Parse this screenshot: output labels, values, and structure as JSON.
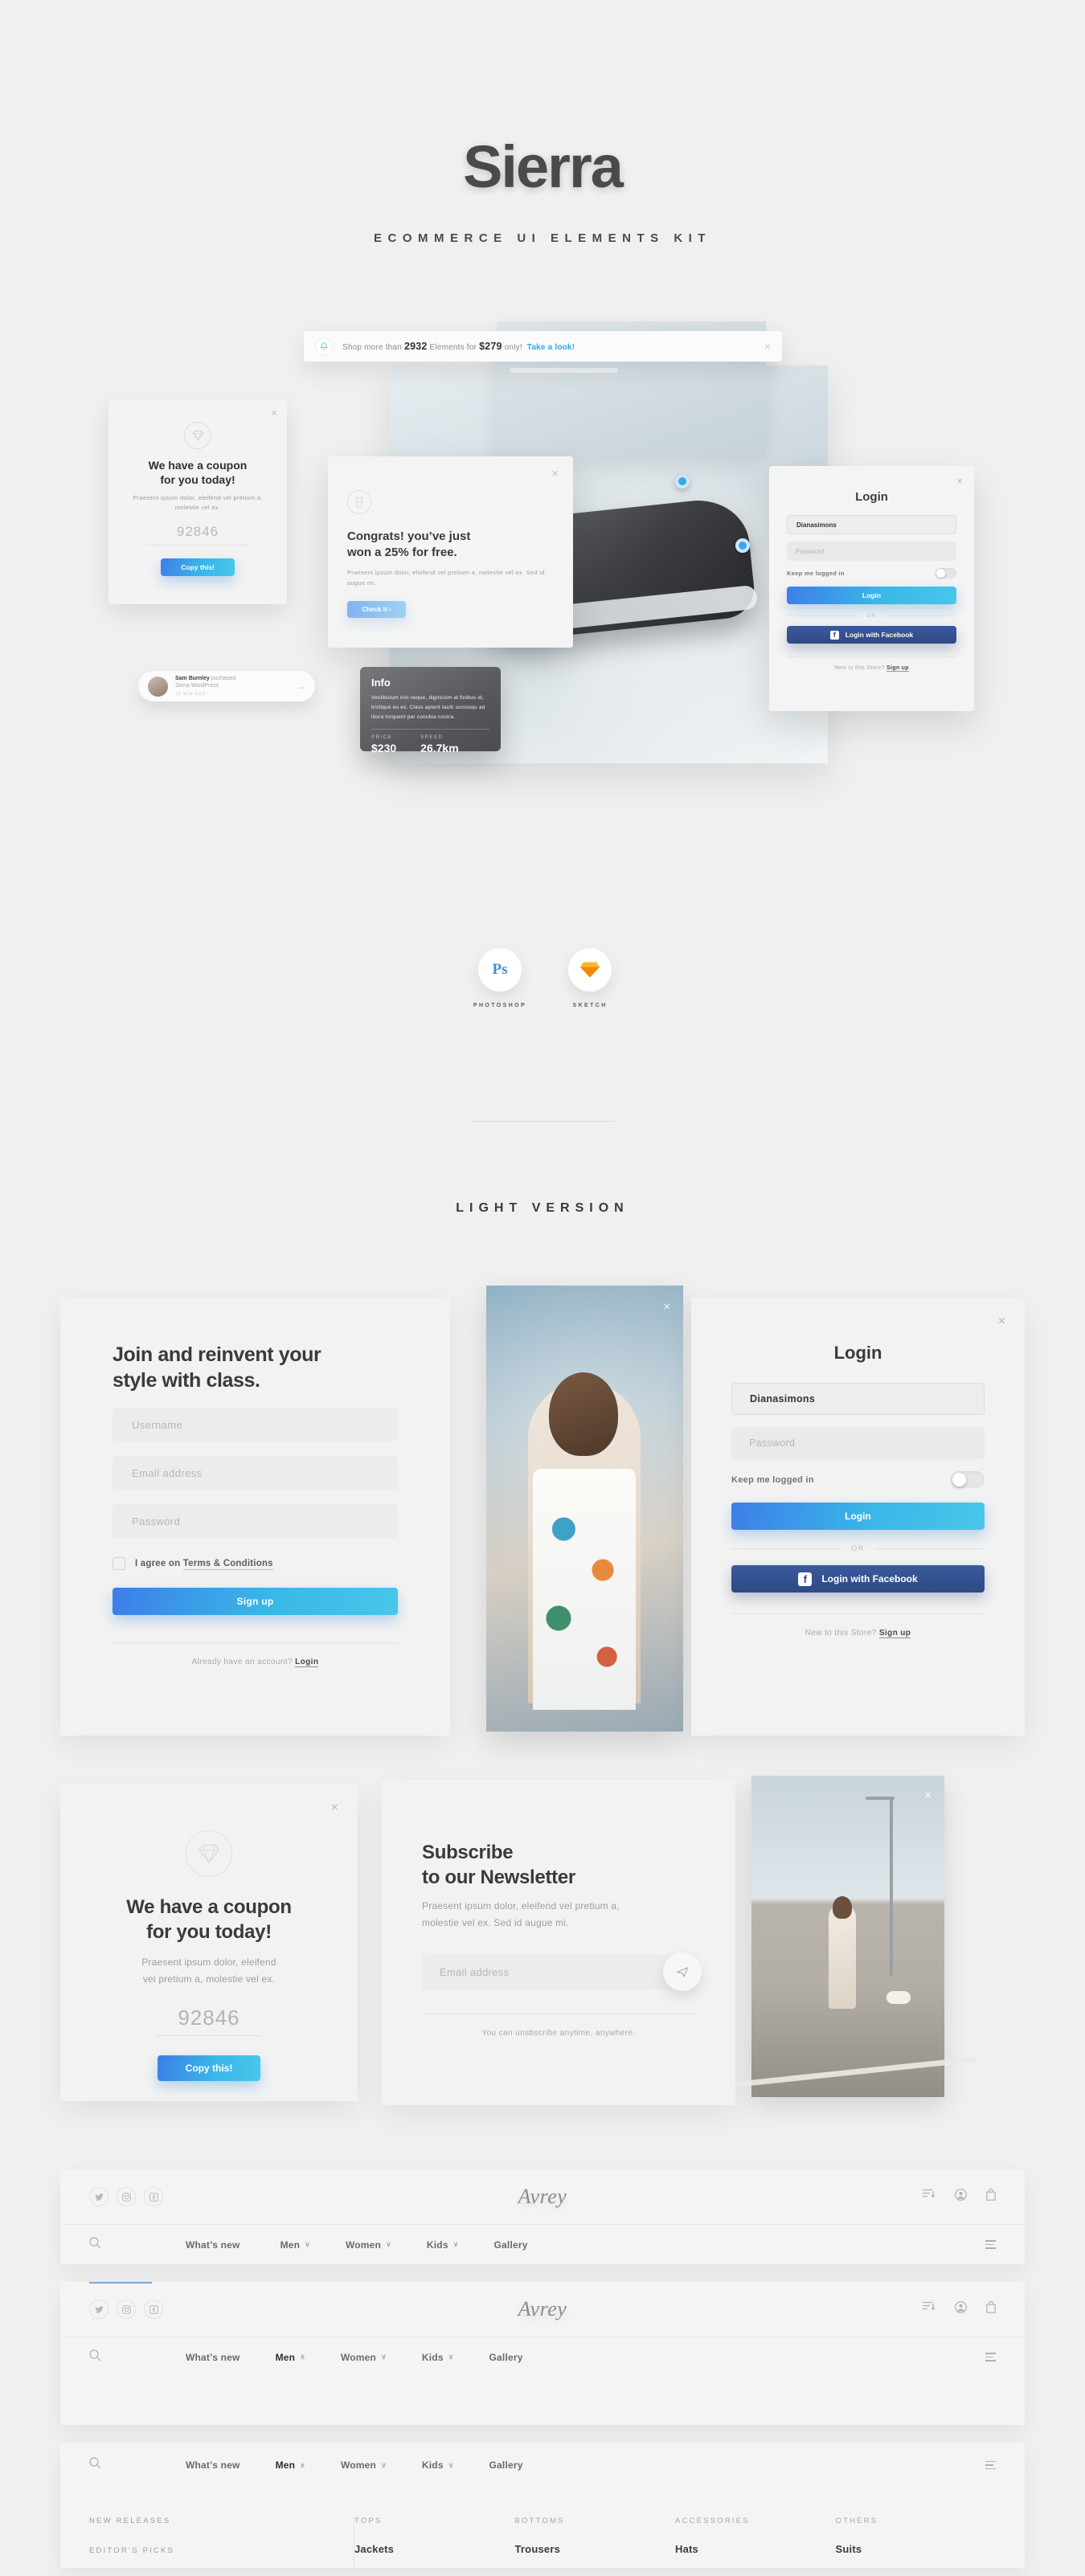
{
  "hero": {
    "title": "Sierra",
    "subtitle": "ECOMMERCE UI ELEMENTS KIT"
  },
  "banner": {
    "icon": "bell-icon",
    "text_before": "Shop more than",
    "count": "2932",
    "text_mid": "Elements for",
    "price": "$279",
    "text_after": "only!",
    "link": "Take a look!",
    "close": "×"
  },
  "coupon_mini": {
    "close": "×",
    "icon": "diamond-icon",
    "heading": "We have a coupon\nfor you today!",
    "heading_line1": "We have a coupon",
    "heading_line2": "for you today!",
    "body": "Praesent ipsum dolor, eleifend vel pretium a, molestie vel ex.",
    "code": "92846",
    "button": "Copy this!"
  },
  "congrats": {
    "close": "×",
    "icon": "medal-icon",
    "heading_line1": "Congrats! you’ve just",
    "heading_line2": "won a 25% for free.",
    "body": "Praesent ipsum dolor, eleifend vel pretium a, molestie vel ex. Sed id augue mi.",
    "button": "Check it ›"
  },
  "info_card": {
    "title": "Info",
    "body": "Vestibulum nisl neque, dignissim at finibus id, tristique eu ex. Class aptent taciti sociosqu ad litora torquent per conubia nostra.",
    "stats": [
      {
        "label": "PRICE",
        "value": "$230"
      },
      {
        "label": "SPEED",
        "value": "26.7km"
      }
    ]
  },
  "toast": {
    "name": "Sam Burnley",
    "action": "puchased",
    "product": "Siena WordPress",
    "time": "35 MIN AGO",
    "arrow": "→"
  },
  "hero_login": {
    "close": "×",
    "title": "Login",
    "username_value": "Dianasimons",
    "password_placeholder": "Password",
    "toggle_label": "Keep me logged in",
    "login_button": "Login",
    "or": "OR",
    "facebook_button": "Login with Facebook",
    "facebook_badge": "f",
    "footer_text": "New to this Store?",
    "footer_link": "Sign up"
  },
  "formats": [
    {
      "icon": "photoshop-icon",
      "glyph": "Ps",
      "label": "PHOTOSHOP"
    },
    {
      "icon": "sketch-icon",
      "glyph": "",
      "label": "SKETCH"
    }
  ],
  "section": {
    "title": "LIGHT VERSION"
  },
  "signup": {
    "heading_line1": "Join and reinvent your",
    "heading_line2": "style with class.",
    "fields": [
      {
        "name": "username-field",
        "placeholder": "Username"
      },
      {
        "name": "email-field",
        "placeholder": "Email address"
      },
      {
        "name": "password-field",
        "placeholder": "Password"
      }
    ],
    "terms_prefix": "I agree on",
    "terms_link": "Terms & Conditions",
    "button": "Sign up",
    "footer_text": "Already have an account?",
    "footer_link": "Login"
  },
  "login": {
    "close": "×",
    "title": "Login",
    "username_value": "Dianasimons",
    "password_placeholder": "Password",
    "toggle_label": "Keep me logged in",
    "login_button": "Login",
    "or": "OR",
    "facebook_button": "Login with Facebook",
    "facebook_badge": "f",
    "footer_text": "New to this Store?",
    "footer_link": "Sign up"
  },
  "coupon": {
    "close": "×",
    "icon": "diamond-icon",
    "heading_line1": "We have a coupon",
    "heading_line2": "for you today!",
    "body_line1": "Praesent ipsum dolor, eleifend",
    "body_line2": "vel pretium a, molestie vel ex.",
    "code": "92846",
    "button": "Copy this!"
  },
  "newsletter": {
    "heading_line1": "Subscribe",
    "heading_line2": "to our Newsletter",
    "body_line1": "Praesent ipsum dolor, eleifend vel pretium a,",
    "body_line2": "molestie vel ex. Sed id augue mi.",
    "placeholder": "Email address",
    "send_icon": "send-icon",
    "footer": "You can unsbscribe anytime, anywhere."
  },
  "photos": {
    "portrait_close": "×",
    "street_close": "×"
  },
  "navbar": {
    "brand": "Avrey",
    "socials": [
      {
        "name": "twitter-icon",
        "glyph": "🐦"
      },
      {
        "name": "instagram-icon",
        "glyph": "▢"
      },
      {
        "name": "facebook-icon",
        "glyph": "f"
      }
    ],
    "icons": [
      {
        "name": "filter-icon"
      },
      {
        "name": "account-icon"
      },
      {
        "name": "bag-icon"
      }
    ],
    "search_icon": "search-icon",
    "menu": [
      {
        "label": "What’s new",
        "caret": ""
      },
      {
        "label": "Men",
        "caret": "∨"
      },
      {
        "label": "Women",
        "caret": "∨"
      },
      {
        "label": "Kids",
        "caret": "∨"
      },
      {
        "label": "Gallery",
        "caret": ""
      }
    ],
    "menu_open": [
      {
        "label": "What’s new",
        "caret": ""
      },
      {
        "label": "Men",
        "caret": "∧"
      },
      {
        "label": "Women",
        "caret": "∨"
      },
      {
        "label": "Kids",
        "caret": "∨"
      },
      {
        "label": "Gallery",
        "caret": ""
      }
    ],
    "burger_icon": "hamburger-icon"
  },
  "mega_menu": {
    "side_links": [
      "NEW RELEASES",
      "EDITOR’S PICKS"
    ],
    "columns": [
      {
        "head": "TOPS",
        "items": [
          "Jackets"
        ]
      },
      {
        "head": "BOTTOMS",
        "items": [
          "Trousers"
        ]
      },
      {
        "head": "ACCESSORIES",
        "items": [
          "Hats"
        ]
      },
      {
        "head": "OTHERS",
        "items": [
          "Suits"
        ]
      }
    ]
  },
  "colors": {
    "page_bg": "#f0f0f0",
    "accent_blue": "#39b7e8",
    "accent_blue_dark": "#3d7ee8",
    "facebook": "#2e4a86",
    "link_blue": "#2ea8e8",
    "text_dark": "#3d3d3d",
    "text_muted": "#9d9d9d",
    "sketch_orange": "#f3900a"
  }
}
